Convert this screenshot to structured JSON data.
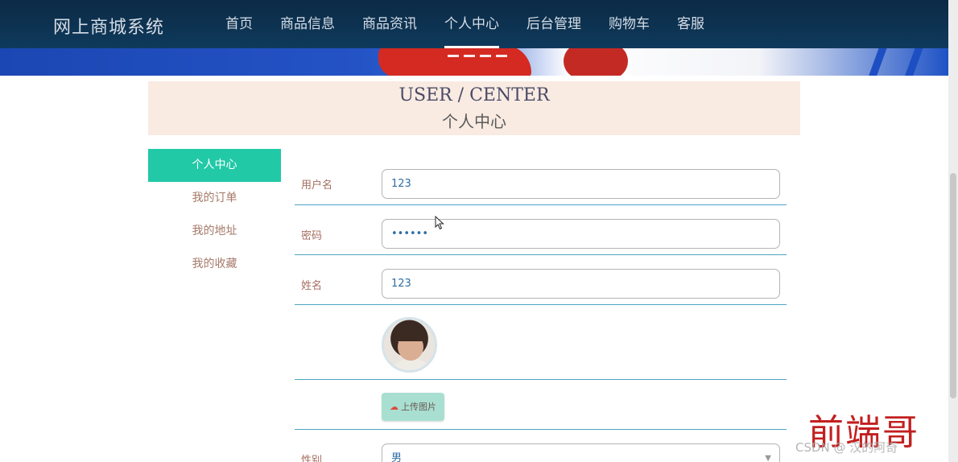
{
  "header": {
    "logo": "网上商城系统",
    "nav": [
      "首页",
      "商品信息",
      "商品资讯",
      "个人中心",
      "后台管理",
      "购物车",
      "客服"
    ],
    "active_index": 3
  },
  "title": {
    "en": "USER / CENTER",
    "cn": "个人中心"
  },
  "sidebar": {
    "items": [
      "个人中心",
      "我的订单",
      "我的地址",
      "我的收藏"
    ],
    "active_index": 0
  },
  "form": {
    "username_label": "用户名",
    "username_value": "123",
    "password_label": "密码",
    "password_value": "••••••",
    "name_label": "姓名",
    "name_value": "123",
    "upload_label": "上传图片",
    "gender_label": "性别",
    "gender_value": "男"
  },
  "watermark": {
    "big": "前端哥",
    "small": "CSDN @ 汉的阿奇"
  },
  "colors": {
    "nav_bg": "#0b2a45",
    "active_menu": "#22c9a7",
    "title_bg": "#f9ebe2",
    "divider": "#4da3c2",
    "watermark_red": "#c31f1f"
  }
}
